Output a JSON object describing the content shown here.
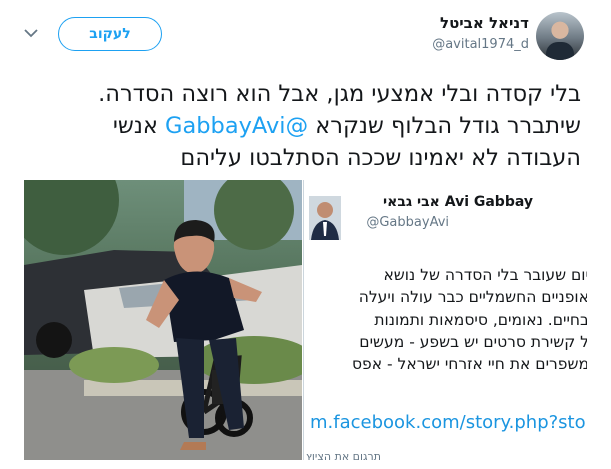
{
  "author": {
    "display_name": "דניאל אביטל",
    "handle": "@avital1974_d"
  },
  "actions": {
    "follow_label": "לעקוב"
  },
  "tweet": {
    "line1": "בלי קסדה ובלי אמצעי מגן, אבל הוא רוצה הסדרה.",
    "line2_before": "שיתברר גודל הבלוף שנקרא ",
    "mention": "@GabbayAvi",
    "line2_after": " אנשי",
    "line3": "העבודה לא יאמינו שככה הסתלבטו עליהם"
  },
  "quoted": {
    "name_latin": "Avi Gabbay",
    "name_hebrew": "אבי גבאי",
    "handle": "@GabbayAvi",
    "lines": [
      "יום שעובר בלי הסדרה של נושא",
      "אופניים החשמליים כבר עולה ויעלה",
      "בחיים. נאומים, סיסמאות ותמונות",
      "ל קשירת סרטים יש בשפע - מעשים",
      "משפרים את חיי אזרחי ישראל - אפס"
    ],
    "link": "m.facebook.com/story.php?sto",
    "cut_text": "תרגום את הציוץ"
  },
  "colors": {
    "accent": "#1da1f2",
    "secondary_text": "#657786"
  },
  "icons": {
    "menu": "chevron-down-icon"
  }
}
